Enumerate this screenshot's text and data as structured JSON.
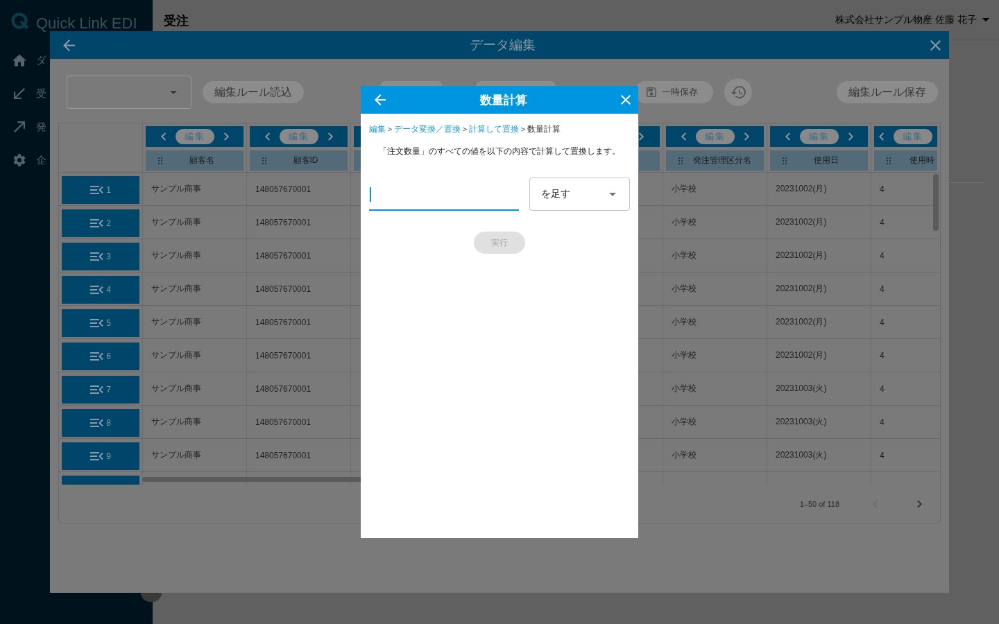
{
  "sidebar": {
    "logo": "Quick Link EDI",
    "items": [
      {
        "label": "ダ"
      },
      {
        "label": "受"
      },
      {
        "label": "発"
      },
      {
        "label": "企"
      }
    ]
  },
  "header": {
    "title": "受注",
    "user": "株式会社サンプル物産 佐藤 花子"
  },
  "data_dialog": {
    "title": "データ編集",
    "toolbar": [
      {
        "kind": "select"
      },
      {
        "kind": "text",
        "label": "編集ルール読込"
      },
      {
        "kind": "covered"
      },
      {
        "kind": "covered"
      },
      {
        "kind": "icon_text",
        "label": "一時保存"
      },
      {
        "kind": "icon"
      },
      {
        "kind": "text",
        "label": "編集ルール保存"
      }
    ],
    "table": {
      "columns": [
        {
          "kind": "full",
          "edit": "編集",
          "label": "顧客名"
        },
        {
          "kind": "full",
          "edit": "編集",
          "label": "顧客ID"
        },
        {
          "kind": "edge_left"
        },
        {
          "kind": "covered"
        },
        {
          "kind": "edge_right"
        },
        {
          "kind": "full",
          "edit": "編集",
          "label": "発注管理区分名"
        },
        {
          "kind": "full",
          "edit": "編集",
          "label": "使用日"
        },
        {
          "kind": "cut",
          "edit": "編集",
          "label": "使用時"
        }
      ],
      "rows": [
        {
          "number": "1",
          "cells": [
            "サンプル商事",
            "148057670001",
            "小学校",
            "20231002(月)",
            "4"
          ]
        },
        {
          "number": "2",
          "cells": [
            "サンプル商事",
            "148057670001",
            "小学校",
            "20231002(月)",
            "4"
          ]
        },
        {
          "number": "3",
          "cells": [
            "サンプル商事",
            "148057670001",
            "小学校",
            "20231002(月)",
            "4"
          ]
        },
        {
          "number": "4",
          "cells": [
            "サンプル商事",
            "148057670001",
            "小学校",
            "20231002(月)",
            "4"
          ]
        },
        {
          "number": "5",
          "cells": [
            "サンプル商事",
            "148057670001",
            "小学校",
            "20231002(月)",
            "4"
          ]
        },
        {
          "number": "6",
          "cells": [
            "サンプル商事",
            "148057670001",
            "小学校",
            "20231002(月)",
            "4"
          ]
        },
        {
          "number": "7",
          "cells": [
            "サンプル商事",
            "148057670001",
            "小学校",
            "20231003(火)",
            "4"
          ]
        },
        {
          "number": "8",
          "cells": [
            "サンプル商事",
            "148057670001",
            "小学校",
            "20231003(火)",
            "4"
          ]
        },
        {
          "number": "9",
          "cells": [
            "サンプル商事",
            "148057670001",
            "小学校",
            "20231003(火)",
            "4"
          ]
        }
      ],
      "clipped_row": true
    },
    "pagination": {
      "range": "1–50 of 118",
      "prev": {
        "disabled": true
      },
      "next": {
        "disabled": false
      }
    }
  },
  "modal": {
    "title": "数量計算",
    "breadcrumb": [
      {
        "kind": "link",
        "text": "編集"
      },
      {
        "kind": "separator",
        "text": "＞"
      },
      {
        "kind": "link",
        "text": "データ変換／置換"
      },
      {
        "kind": "separator",
        "text": "＞"
      },
      {
        "kind": "link",
        "text": "計算して置換"
      },
      {
        "kind": "separator",
        "text": "＞"
      },
      {
        "kind": "current",
        "text": "数量計算"
      }
    ],
    "description": "「注文数量」のすべての値を以下の内容で計算して置換します。",
    "amount_field": {
      "focused": true
    },
    "operation_select": {
      "value": "を足す"
    },
    "run_button": {
      "label": "実行",
      "disabled": true
    }
  }
}
